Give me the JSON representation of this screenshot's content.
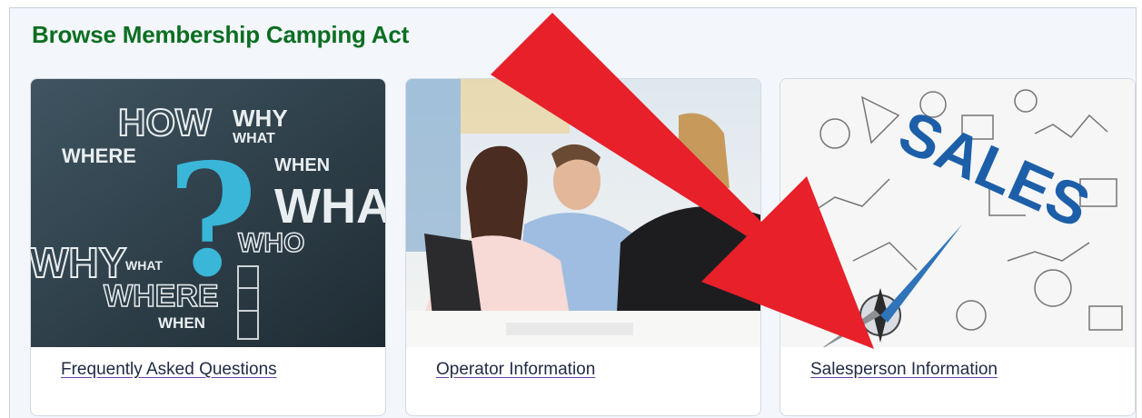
{
  "section": {
    "title": "Browse Membership Camping Act"
  },
  "cards": [
    {
      "link": "Frequently Asked Questions",
      "image_words": {
        "how": "HOW",
        "why": "WHY",
        "what": "WHAT",
        "where": "WHERE",
        "when": "WHEN",
        "wha": "WHA",
        "who": "WHO",
        "why_big": "WHY",
        "what_small": "WHAT",
        "where_big": "WHERE",
        "when_small": "WHEN",
        "qmark": "?"
      }
    },
    {
      "link": "Operator Information"
    },
    {
      "link": "Salesperson Information",
      "image_words": {
        "sales": "SALES"
      }
    }
  ],
  "colors": {
    "title": "#0b6e22",
    "arrow": "#e8202a",
    "chalk": "#2f3d46",
    "question": "#39b6d8",
    "sales_blue": "#1c5fa8"
  }
}
